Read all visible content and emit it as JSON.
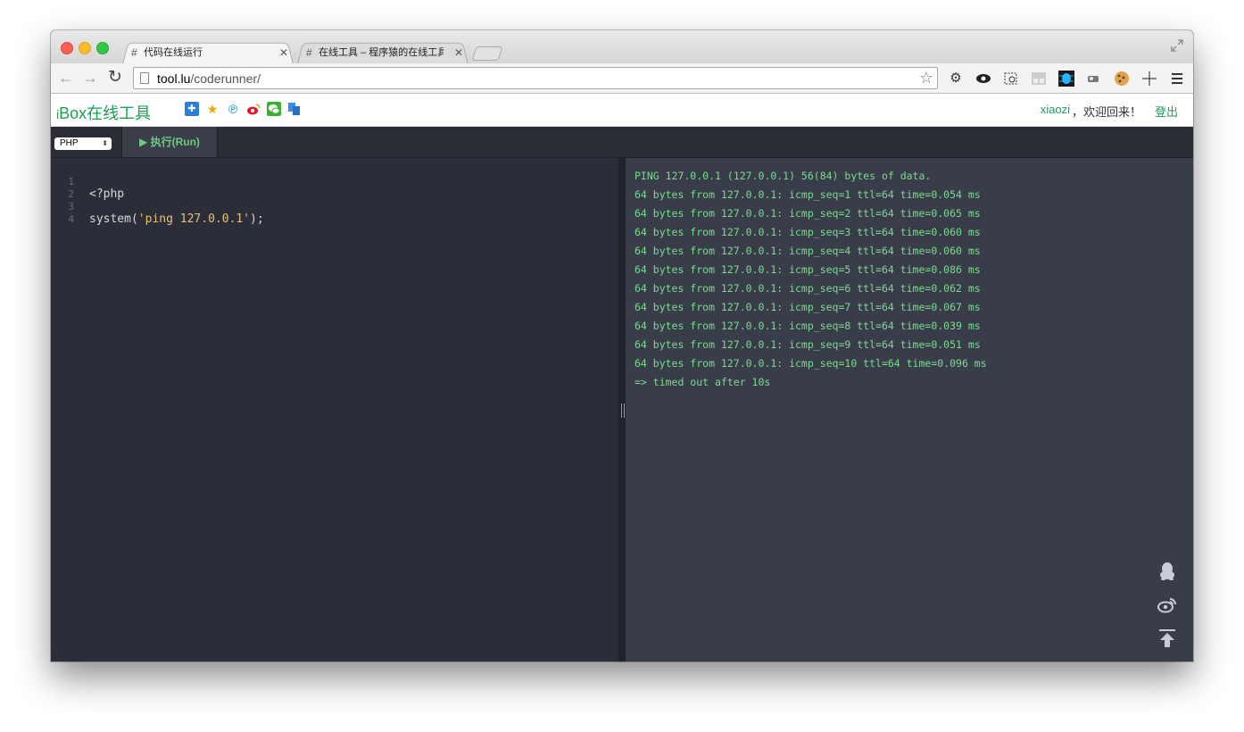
{
  "browser": {
    "tabs": [
      {
        "label": "代码在线运行",
        "active": true
      },
      {
        "label": "在线工具 – 程序猿的在线工具",
        "active": false
      }
    ],
    "address": {
      "host": "tool.lu",
      "path": "/coderunner/"
    }
  },
  "site": {
    "logo_prefix": "i",
    "logo_text": "Box在线工具",
    "username": "xiaozi",
    "welcome": "，欢迎回来！",
    "logout": "登出"
  },
  "editor_toolbar": {
    "language": "PHP",
    "run_label": "▶ 执行(Run)"
  },
  "code": {
    "lines": [
      {
        "num": "1",
        "text": "<?php"
      },
      {
        "num": "2",
        "text": ""
      },
      {
        "num": "3",
        "prefix": "system(",
        "string": "'ping 127.0.0.1'",
        "suffix": ");"
      },
      {
        "num": "4",
        "text": ""
      }
    ]
  },
  "output": {
    "lines": [
      "PING 127.0.0.1 (127.0.0.1) 56(84) bytes of data.",
      "64 bytes from 127.0.0.1: icmp_seq=1 ttl=64 time=0.054 ms",
      "64 bytes from 127.0.0.1: icmp_seq=2 ttl=64 time=0.065 ms",
      "64 bytes from 127.0.0.1: icmp_seq=3 ttl=64 time=0.060 ms",
      "64 bytes from 127.0.0.1: icmp_seq=4 ttl=64 time=0.060 ms",
      "64 bytes from 127.0.0.1: icmp_seq=5 ttl=64 time=0.086 ms",
      "64 bytes from 127.0.0.1: icmp_seq=6 ttl=64 time=0.062 ms",
      "64 bytes from 127.0.0.1: icmp_seq=7 ttl=64 time=0.067 ms",
      "64 bytes from 127.0.0.1: icmp_seq=8 ttl=64 time=0.039 ms",
      "64 bytes from 127.0.0.1: icmp_seq=9 ttl=64 time=0.051 ms",
      "64 bytes from 127.0.0.1: icmp_seq=10 ttl=64 time=0.096 ms",
      "=> timed out after 10s"
    ]
  },
  "icons": {
    "share": [
      "qzone-icon",
      "favorite-icon",
      "pinterest-icon",
      "weibo-icon",
      "wechat-icon",
      "copy-icon"
    ],
    "side": [
      "qq-icon",
      "weibo-icon",
      "back-to-top-icon"
    ]
  },
  "colors": {
    "accent": "#1d9f55",
    "output_text": "#7ed992",
    "editor_bg": "#2b2e38",
    "output_bg": "#393d49"
  }
}
